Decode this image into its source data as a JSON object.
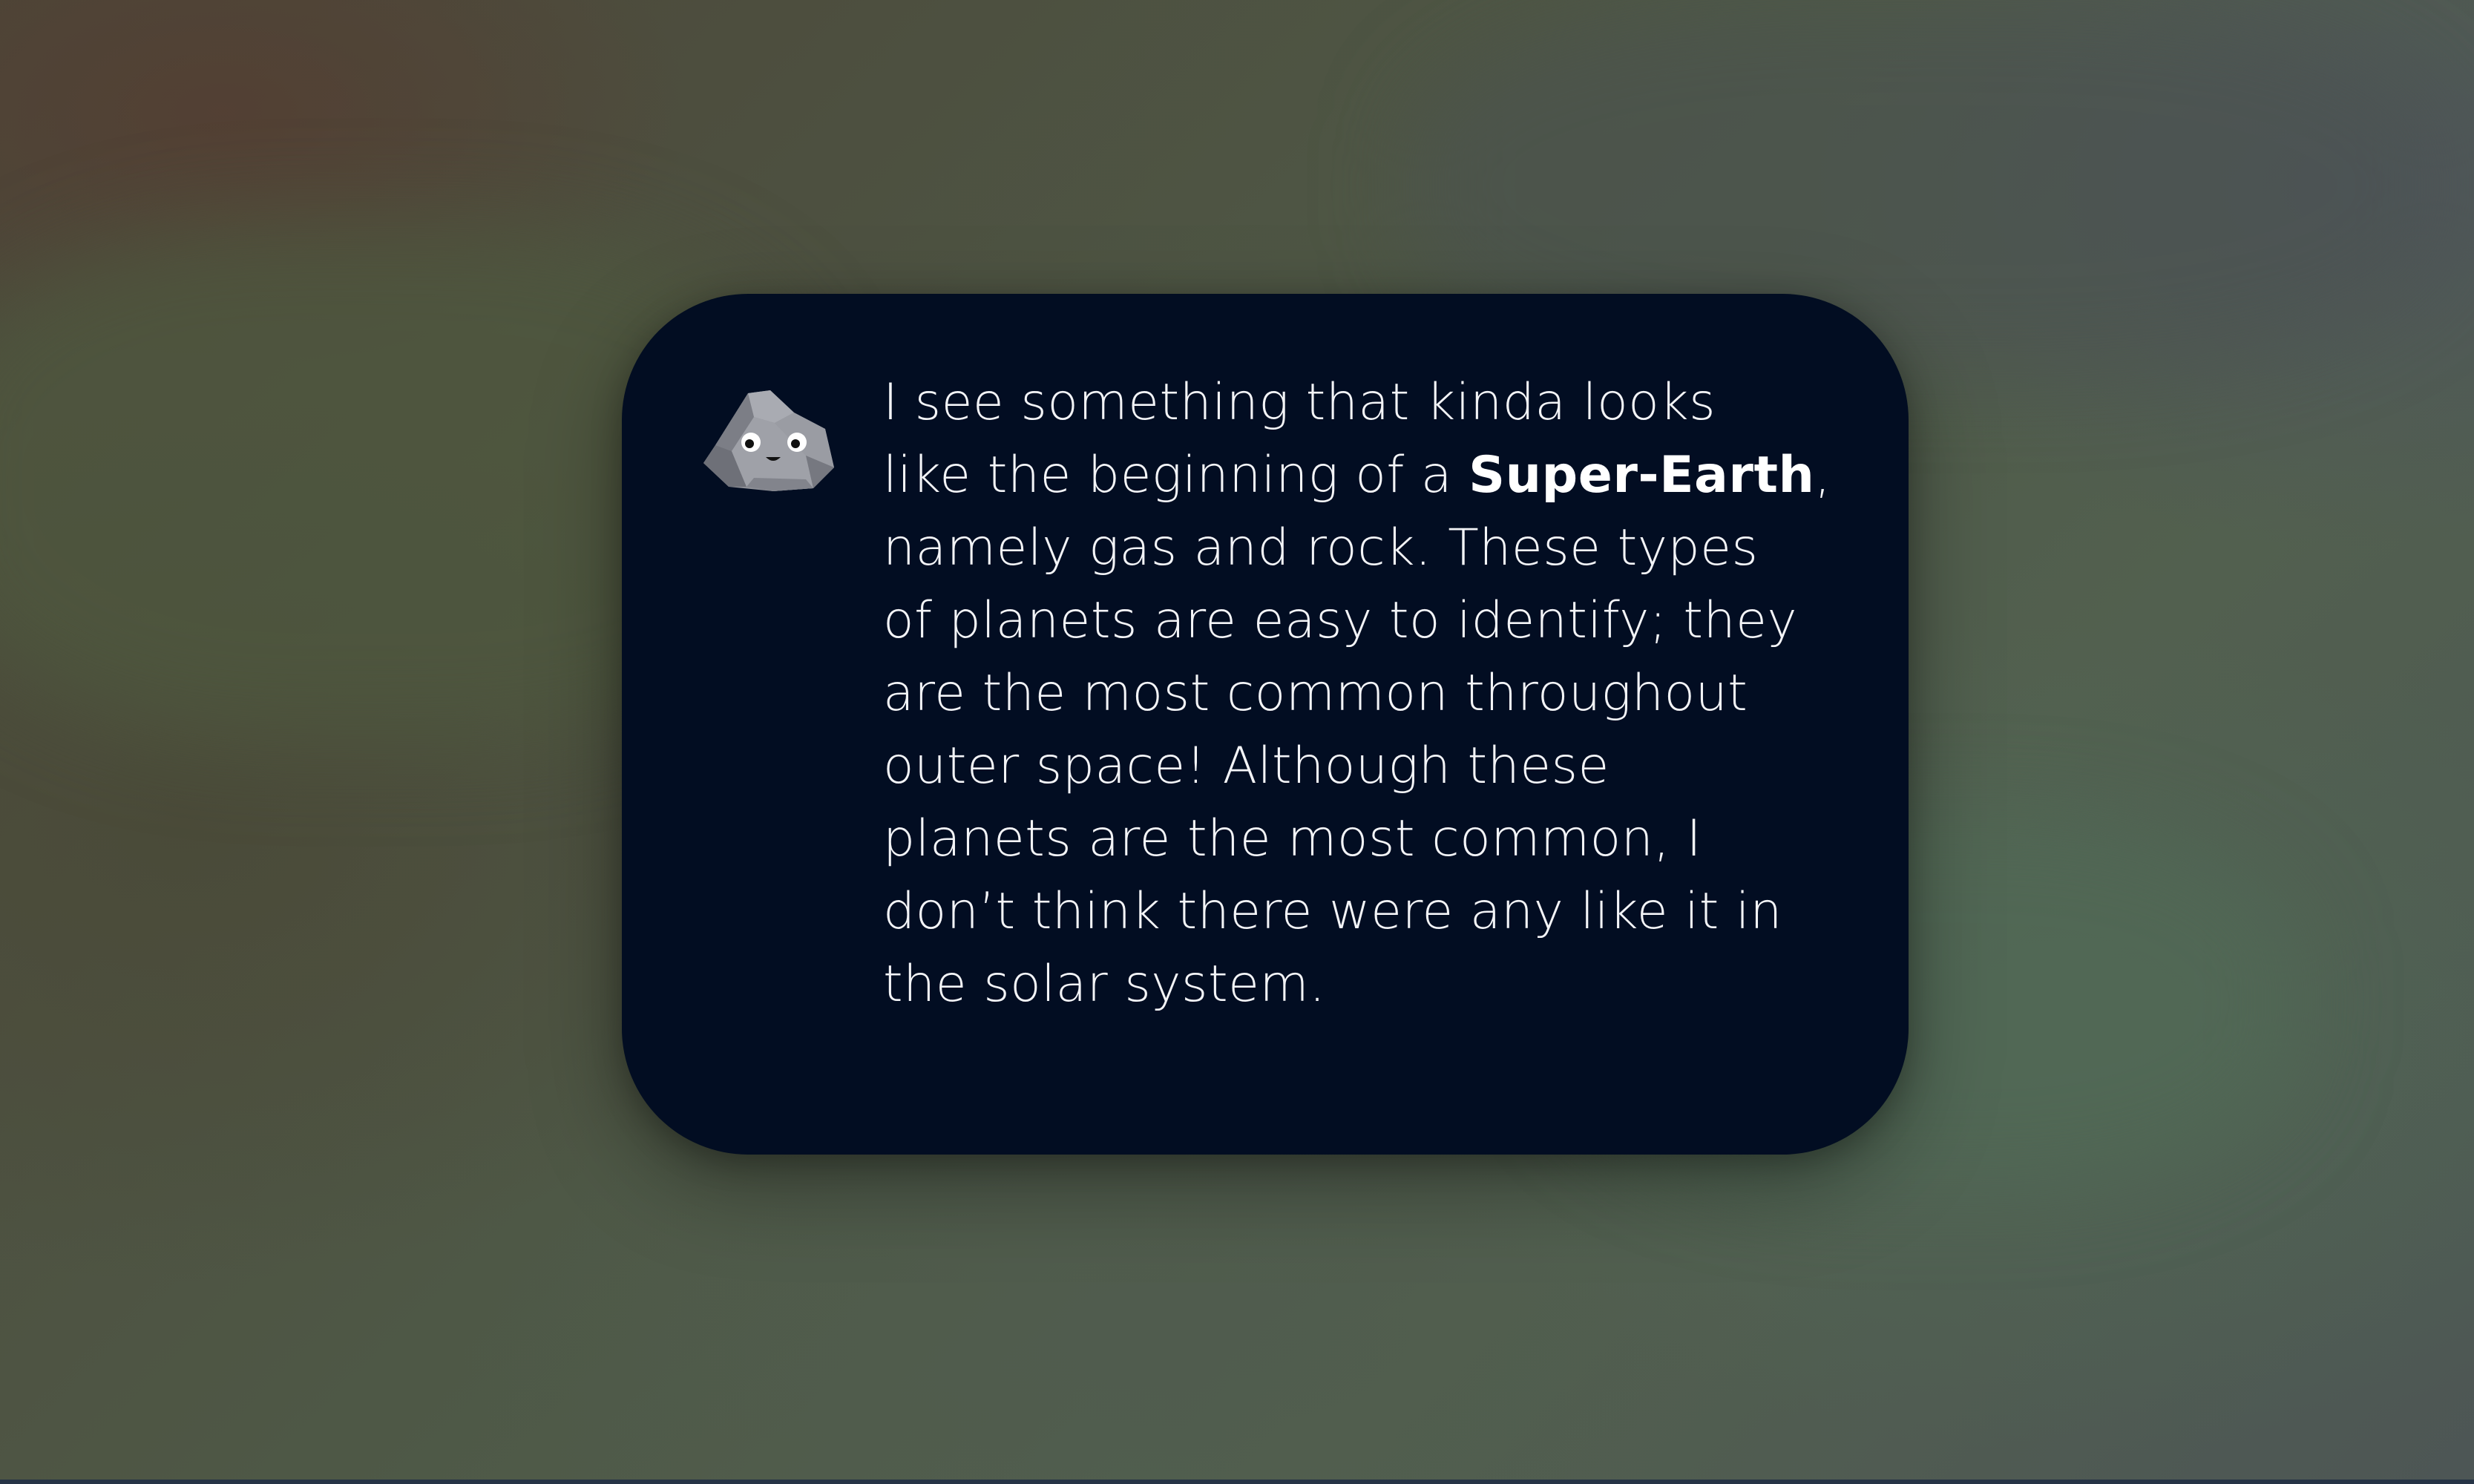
{
  "dialog": {
    "lines": {
      "l1": "I see something that kinda looks",
      "l2_before": "like the beginning of a ",
      "l2_bold": "Super-Earth",
      "l2_after": ",",
      "l3": "namely gas and rock. These types",
      "l4": "of planets are easy to identify; they",
      "l5": "are the most common throughout",
      "l6": "outer space! Although these",
      "l7": "planets are the most common, I",
      "l8": "don’t think there were any like it in",
      "l9": "the solar system."
    },
    "avatar_icon": "rock-character-icon",
    "card_color": "#020d22",
    "text_color": "#f3f4f7"
  }
}
